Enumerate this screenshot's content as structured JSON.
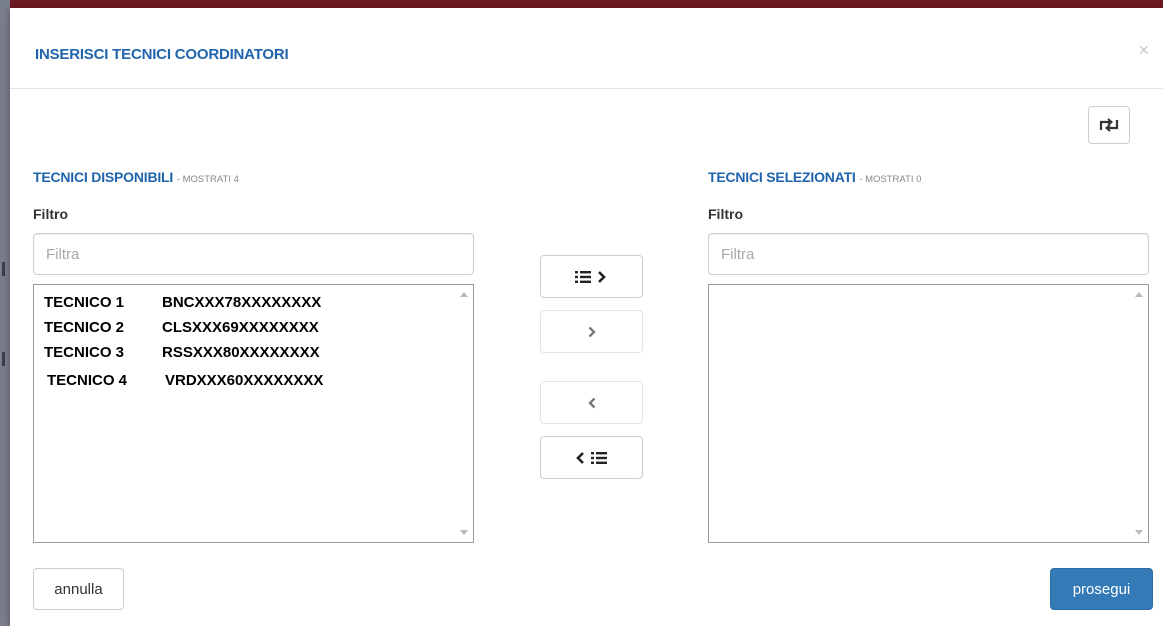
{
  "modal": {
    "title": "INSERISCI TECNICI COORDINATORI",
    "close_symbol": "×",
    "refresh_icon": "swap-arrows-icon"
  },
  "available": {
    "heading": "TECNICI DISPONIBILI",
    "count_text": "- MOSTRATI 4",
    "filter_label": "Filtro",
    "filter_placeholder": "Filtra",
    "items": [
      {
        "name": "TECNICO 1",
        "code": "BNCXXX78XXXXXXXX"
      },
      {
        "name": "TECNICO 2",
        "code": "CLSXXX69XXXXXXXX"
      },
      {
        "name": "TECNICO 3",
        "code": "RSSXXX80XXXXXXXX"
      },
      {
        "name": "TECNICO 4",
        "code": "VRDXXX60XXXXXXXX"
      }
    ]
  },
  "selected": {
    "heading": "TECNICI SELEZIONATI",
    "count_text": "- MOSTRATI 0",
    "filter_label": "Filtro",
    "filter_placeholder": "Filtra",
    "items": []
  },
  "move_buttons": {
    "move_all_right_icon": "list-chevron-right-icon",
    "move_right_icon": "chevron-right-icon",
    "move_left_icon": "chevron-left-icon",
    "move_all_left_icon": "chevron-left-list-icon"
  },
  "footer": {
    "cancel_label": "annulla",
    "continue_label": "prosegui"
  },
  "colors": {
    "title_blue": "#1f64ad",
    "primary_button": "#337ab7"
  }
}
